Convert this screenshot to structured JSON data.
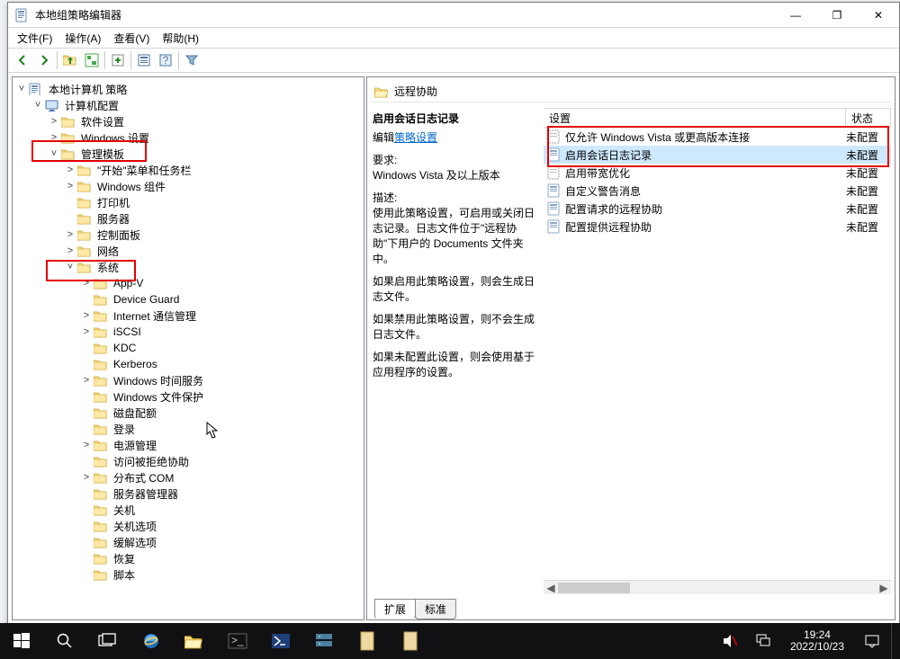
{
  "window": {
    "title": "本地组策略编辑器",
    "menu": {
      "file": "文件(F)",
      "action": "操作(A)",
      "view": "查看(V)",
      "help": "帮助(H)"
    },
    "win_buttons": {
      "min": "—",
      "max": "❐",
      "close": "✕"
    }
  },
  "tree": {
    "root": "本地计算机 策略",
    "computerConfig": "计算机配置",
    "softwareSettings": "软件设置",
    "windowsSettings": "Windows 设置",
    "adminTemplates": "管理模板",
    "startMenu": "\"开始\"菜单和任务栏",
    "windowsComponents": "Windows 组件",
    "printers": "打印机",
    "servers": "服务器",
    "controlPanel": "控制面板",
    "network": "网络",
    "system": "系统",
    "sys": {
      "appv": "App-V",
      "deviceGuard": "Device Guard",
      "internetComm": "Internet 通信管理",
      "iscsi": "iSCSI",
      "kdc": "KDC",
      "kerberos": "Kerberos",
      "winTime": "Windows 时间服务",
      "winFileProt": "Windows 文件保护",
      "diskQuota": "磁盘配额",
      "logon": "登录",
      "power": "电源管理",
      "accessDenied": "访问被拒绝协助",
      "dcom": "分布式 COM",
      "serverMgr": "服务器管理器",
      "shutdown": "关机",
      "shutdownOpt": "关机选项",
      "mitigation": "缓解选项",
      "recovery": "恢复",
      "scripts": "脚本"
    }
  },
  "right": {
    "header": "远程协助",
    "detail": {
      "title": "启用会话日志记录",
      "editPrefix": "编辑",
      "editLink": "策略设置",
      "reqLabel": "要求:",
      "reqValue": "Windows Vista 及以上版本",
      "descLabel": "描述:",
      "desc1": "使用此策略设置，可启用或关闭日志记录。日志文件位于\"远程协助\"下用户的 Documents 文件夹中。",
      "desc2": "如果启用此策略设置，则会生成日志文件。",
      "desc3": "如果禁用此策略设置，则不会生成日志文件。",
      "desc4": "如果未配置此设置，则会使用基于应用程序的设置。"
    },
    "cols": {
      "setting": "设置",
      "state": "状态"
    },
    "rows": [
      {
        "label": "仅允许 Windows Vista 或更高版本连接",
        "state": "未配置",
        "dashed": true
      },
      {
        "label": "启用会话日志记录",
        "state": "未配置",
        "selected": true
      },
      {
        "label": "启用带宽优化",
        "state": "未配置",
        "dashed": true
      },
      {
        "label": "自定义警告消息",
        "state": "未配置"
      },
      {
        "label": "配置请求的远程协助",
        "state": "未配置"
      },
      {
        "label": "配置提供远程协助",
        "state": "未配置"
      }
    ],
    "tabs": {
      "ext": "扩展",
      "std": "标准"
    }
  },
  "task": {
    "time": "19:24",
    "date": "2022/10/23"
  }
}
